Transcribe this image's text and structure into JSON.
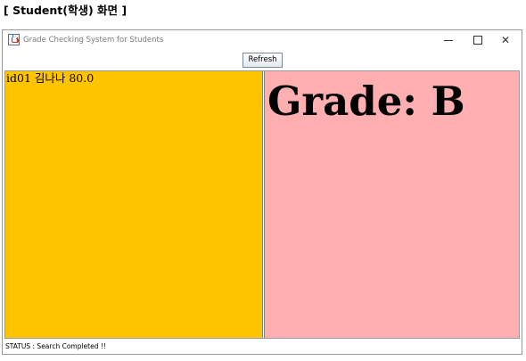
{
  "caption": "[ Student(학생) 화면 ]",
  "window": {
    "title": "Grade Checking System for Students",
    "icon": "java-cup-icon",
    "controls": {
      "minimize": "minimize-icon",
      "maximize": "maximize-icon",
      "close_glyph": "✕"
    }
  },
  "toolbar": {
    "refresh_label": "Refresh"
  },
  "left_panel": {
    "background": "#ffc400",
    "record": "id01 김나나 80.0"
  },
  "right_panel": {
    "background": "#ffafaf",
    "grade": "Grade: B"
  },
  "status": {
    "text": "STATUS : Search Completed !!"
  }
}
